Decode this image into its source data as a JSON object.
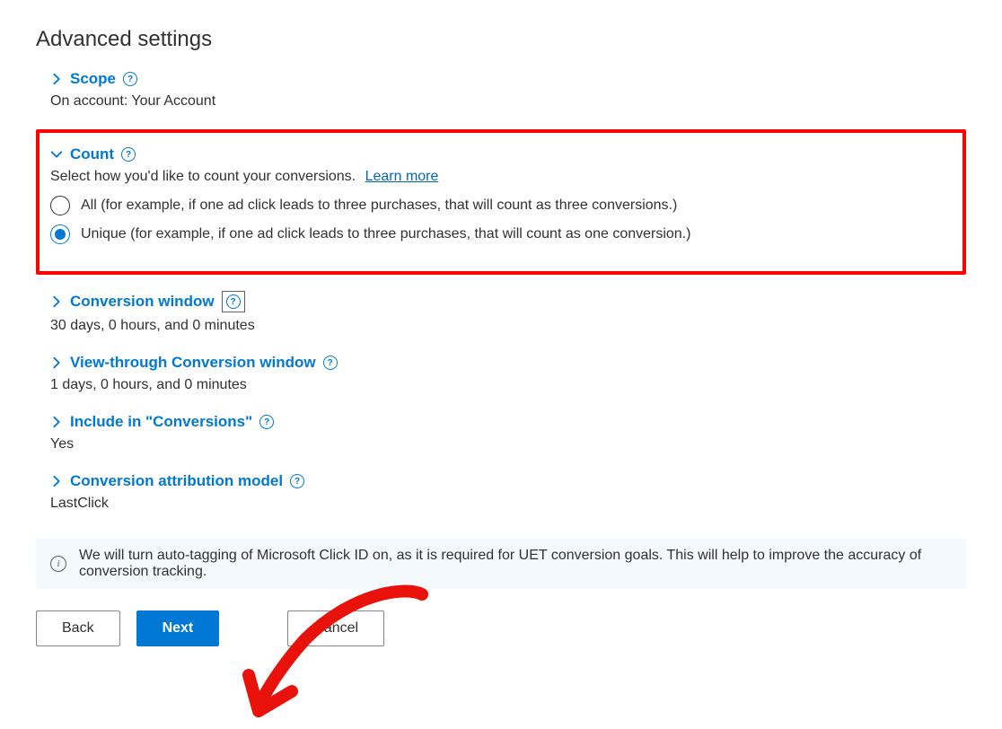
{
  "page_title": "Advanced settings",
  "sections": {
    "scope": {
      "label": "Scope",
      "value": "On account: Your Account"
    },
    "count": {
      "label": "Count",
      "desc": "Select how you'd like to count your conversions.",
      "learn_more": "Learn more",
      "options": {
        "all": "All (for example, if one ad click leads to three purchases, that will count as three conversions.)",
        "unique": "Unique (for example, if one ad click leads to three purchases, that will count as one conversion.)"
      },
      "selected": "unique"
    },
    "conversion_window": {
      "label": "Conversion window",
      "value": "30 days, 0 hours, and 0 minutes"
    },
    "view_through": {
      "label": "View-through Conversion window",
      "value": "1 days, 0 hours, and 0 minutes"
    },
    "include": {
      "label": "Include in \"Conversions\"",
      "value": "Yes"
    },
    "attribution": {
      "label": "Conversion attribution model",
      "value": "LastClick"
    }
  },
  "info_banner": "We will turn auto-tagging of Microsoft Click ID on, as it is required for UET conversion goals. This will help to improve the accuracy of conversion tracking.",
  "buttons": {
    "back": "Back",
    "next": "Next",
    "cancel": "Cancel"
  }
}
